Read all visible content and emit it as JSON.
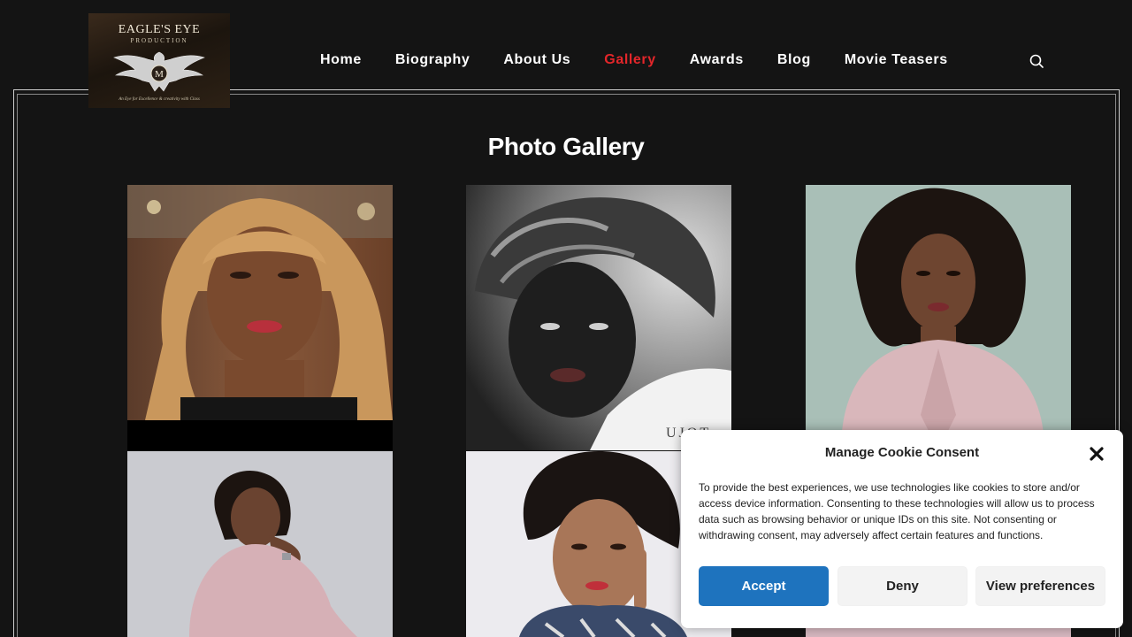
{
  "logo": {
    "brand": "EAGLE'S EYE",
    "brand_sub": "PRODUCTION",
    "monogram": "M",
    "tagline": "An Eye for Excellence & creativity with Class"
  },
  "nav": {
    "items": [
      {
        "label": "Home"
      },
      {
        "label": "Biography"
      },
      {
        "label": "About Us"
      },
      {
        "label": "Gallery",
        "active": true
      },
      {
        "label": "Awards"
      },
      {
        "label": "Blog"
      },
      {
        "label": "Movie Teasers"
      }
    ],
    "active_color": "#e3262a"
  },
  "search": {
    "icon": "search-icon"
  },
  "page": {
    "title": "Photo Gallery"
  },
  "gallery": {
    "photos": [
      {
        "alt": "portrait-blonde-wig"
      },
      {
        "alt": "portrait-monochrome",
        "watermark": "UJOT"
      },
      {
        "alt": "portrait-pink-blazer"
      },
      {
        "alt": "portrait-seated-pink"
      },
      {
        "alt": "portrait-finger-to-lips"
      },
      {
        "alt": "portrait-partial"
      }
    ]
  },
  "cookie": {
    "title": "Manage Cookie Consent",
    "body": "To provide the best experiences, we use technologies like cookies to store and/or access device information. Consenting to these technologies will allow us to process data such as browsing behavior or unique IDs on this site. Not consenting or withdrawing consent, may adversely affect certain features and functions.",
    "accept_label": "Accept",
    "deny_label": "Deny",
    "preferences_label": "View preferences",
    "accent_color": "#1e73be"
  }
}
